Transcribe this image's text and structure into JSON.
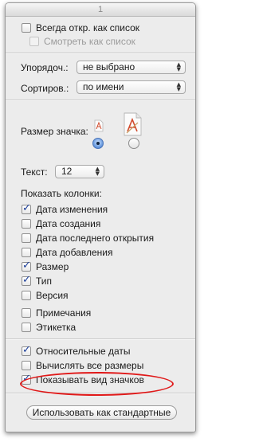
{
  "window": {
    "title": "1"
  },
  "top_options": {
    "always_open_list": {
      "label": "Всегда откр. как список",
      "checked": false
    },
    "browse_as_list": {
      "label": "Смотреть как список",
      "checked": false,
      "enabled": false
    }
  },
  "sorting": {
    "arrange_label": "Упорядоч.:",
    "arrange_value": "не выбрано",
    "sort_label": "Сортиров.:",
    "sort_value": "по имени"
  },
  "icon_size": {
    "label": "Размер значка:",
    "small_icon": "document-icon",
    "large_icon": "document-icon",
    "selected": "small"
  },
  "text_size": {
    "label": "Текст:",
    "value": "12"
  },
  "columns": {
    "heading": "Показать колонки:",
    "items": [
      {
        "label": "Дата изменения",
        "checked": true
      },
      {
        "label": "Дата создания",
        "checked": false
      },
      {
        "label": "Дата последнего открытия",
        "checked": false
      },
      {
        "label": "Дата добавления",
        "checked": false
      },
      {
        "label": "Размер",
        "checked": true
      },
      {
        "label": "Тип",
        "checked": true
      },
      {
        "label": "Версия",
        "checked": false
      },
      {
        "label": "Примечания",
        "checked": false
      },
      {
        "label": "Этикетка",
        "checked": false
      }
    ]
  },
  "bottom_options": {
    "relative_dates": {
      "label": "Относительные даты",
      "checked": true
    },
    "calculate_sizes": {
      "label": "Вычислять все размеры",
      "checked": false
    },
    "show_icon_preview": {
      "label": "Показывать вид значков",
      "checked": true
    }
  },
  "use_as_defaults_button": "Использовать как стандартные",
  "annotation": {
    "color": "#e01919"
  }
}
